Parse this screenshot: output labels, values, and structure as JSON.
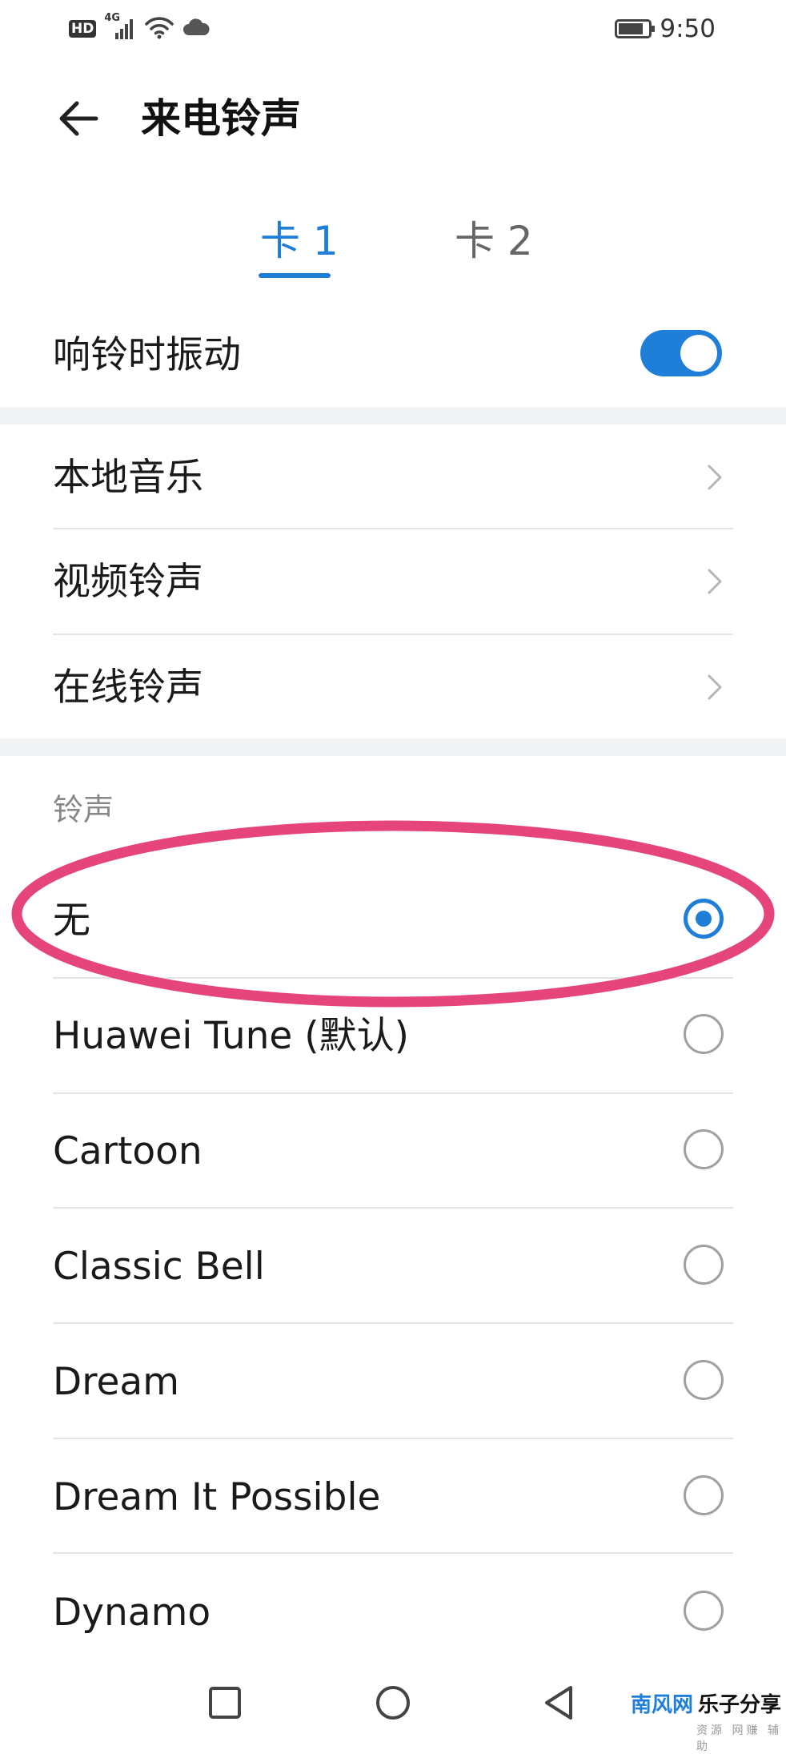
{
  "status_bar": {
    "network_badge": "HD",
    "network_type": "4G",
    "time": "9:50",
    "battery_level": 0.85,
    "icons": [
      "hd-icon",
      "signal-icon",
      "wifi-icon",
      "cloud-icon",
      "battery-icon"
    ]
  },
  "header": {
    "title": "来电铃声",
    "back_icon": "back-arrow-icon"
  },
  "tabs": [
    {
      "label": "卡 1",
      "selected": true
    },
    {
      "label": "卡 2",
      "selected": false
    }
  ],
  "vibrate": {
    "label": "响铃时振动",
    "enabled": true
  },
  "nav_items": [
    {
      "label": "本地音乐"
    },
    {
      "label": "视频铃声"
    },
    {
      "label": "在线铃声"
    }
  ],
  "ringtones": {
    "header": "铃声",
    "items": [
      {
        "label": "无",
        "selected": true
      },
      {
        "label": "Huawei Tune (默认)",
        "selected": false
      },
      {
        "label": "Cartoon",
        "selected": false
      },
      {
        "label": "Classic Bell",
        "selected": false
      },
      {
        "label": "Dream",
        "selected": false
      },
      {
        "label": "Dream It Possible",
        "selected": false
      },
      {
        "label": "Dynamo",
        "selected": false
      }
    ]
  },
  "colors": {
    "accent": "#1f7ed8",
    "annotation": "#e5457a",
    "section_bg": "#f1f3f5"
  },
  "watermark": {
    "site": "南风网",
    "brand": "乐子分享",
    "sub": "资源 网赚 辅助"
  },
  "navbar": {
    "icons": [
      "recent-apps-square-icon",
      "home-circle-icon",
      "back-triangle-icon"
    ]
  }
}
